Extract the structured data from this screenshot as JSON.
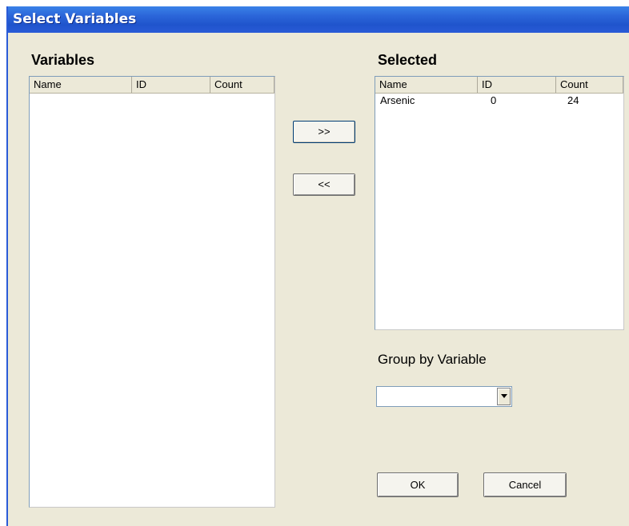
{
  "window": {
    "title": "Select Variables"
  },
  "variables": {
    "label": "Variables",
    "columns": [
      "Name",
      "ID",
      "Count"
    ],
    "rows": []
  },
  "selected": {
    "label": "Selected",
    "columns": [
      "Name",
      "ID",
      "Count"
    ],
    "rows": [
      {
        "name": "Arsenic",
        "id": "0",
        "count": "24"
      }
    ]
  },
  "buttons": {
    "add": ">>",
    "remove": "<<",
    "ok": "OK",
    "cancel": "Cancel"
  },
  "group_by": {
    "label": "Group by Variable",
    "value": ""
  }
}
